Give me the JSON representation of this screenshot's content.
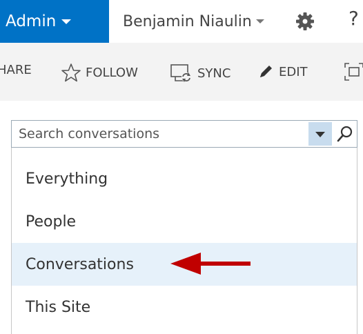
{
  "suite_bar": {
    "admin_label": "Admin",
    "user_name": "Benjamin Niaulin",
    "help_label": "?"
  },
  "action_bar": {
    "share_label": "HARE",
    "follow_label": "FOLLOW",
    "sync_label": "SYNC",
    "edit_label": "EDIT"
  },
  "search": {
    "placeholder": "Search conversations",
    "value": ""
  },
  "scope_menu": {
    "items": [
      {
        "label": "Everything"
      },
      {
        "label": "People"
      },
      {
        "label": "Conversations",
        "selected": true
      },
      {
        "label": "This Site"
      }
    ]
  },
  "colors": {
    "brand": "#0072c6",
    "annotation_arrow": "#c00000",
    "selected_row": "#e6f1fa"
  }
}
